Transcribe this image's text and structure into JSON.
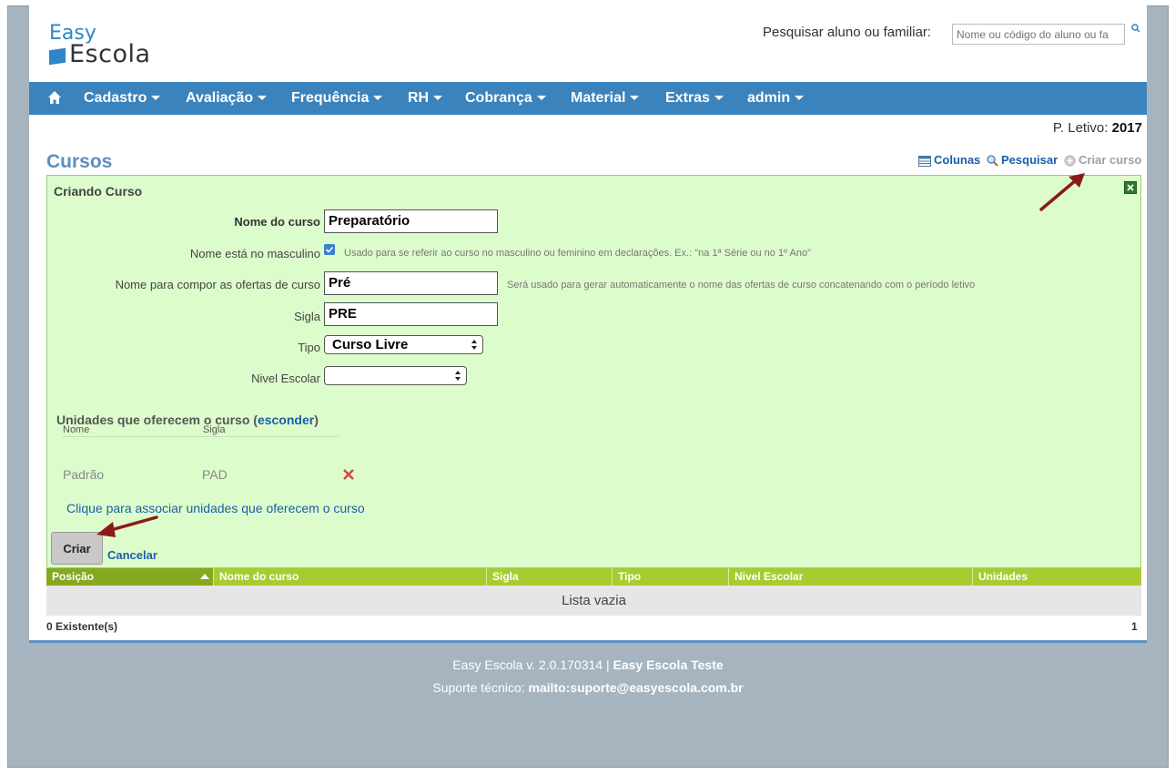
{
  "logo": {
    "top": "Easy",
    "bottom": "Escola"
  },
  "search": {
    "label": "Pesquisar aluno ou familiar:",
    "placeholder": "Nome ou código do aluno ou fa"
  },
  "nav": {
    "items": [
      "Cadastro",
      "Avaliação",
      "Frequência",
      "RH",
      "Cobrança",
      "Material",
      "Extras",
      "admin"
    ]
  },
  "periodo": {
    "label": "P. Letivo:",
    "value": "2017"
  },
  "page": {
    "title": "Cursos"
  },
  "actions": {
    "colunas": "Colunas",
    "pesquisar": "Pesquisar",
    "criar_curso": "Criar curso"
  },
  "form": {
    "header": "Criando Curso",
    "nome_label": "Nome do curso",
    "nome_value": "Preparatório",
    "masculino_label": "Nome está no masculino",
    "masculino_checked": true,
    "masculino_hint": "Usado para se referir ao curso no masculino ou feminino em declarações. Ex.: \"na 1ª Série ou no 1º Ano\"",
    "ofertas_label": "Nome para compor as ofertas de curso",
    "ofertas_value": "Pré",
    "ofertas_hint": "Será usado para gerar automaticamente o nome das ofertas de curso concatenando com o período letivo",
    "sigla_label": "Sigla",
    "sigla_value": "PRE",
    "tipo_label": "Tipo",
    "tipo_value": "Curso Livre",
    "nivel_label": "Nivel Escolar",
    "nivel_value": ""
  },
  "units": {
    "header": "Unidades que oferecem o curso (",
    "hide_link": "esconder",
    "header_close": ")",
    "col_nome": "Nome",
    "col_sigla": "Sigla",
    "rows": [
      {
        "nome": "Padrão",
        "sigla": "PAD"
      }
    ],
    "assoc_link": "Clique para associar unidades que oferecem o curso"
  },
  "buttons": {
    "criar": "Criar",
    "cancelar": "Cancelar"
  },
  "table": {
    "columns": [
      "Posição",
      "Nome do curso",
      "Sigla",
      "Tipo",
      "Nivel Escolar",
      "Unidades"
    ],
    "empty": "Lista vazia",
    "count": "0 Existente(s)",
    "page": "1"
  },
  "footer": {
    "version": "Easy Escola v. 2.0.170314 | ",
    "env": "Easy Escola Teste",
    "support_label": "Suporte técnico: ",
    "support_email": "mailto:suporte@easyescola.com.br"
  },
  "colors": {
    "nav": "#3b83bc",
    "panel": "#ddfccc",
    "table_header": "#a8cc30",
    "link": "#1a5ea8"
  }
}
